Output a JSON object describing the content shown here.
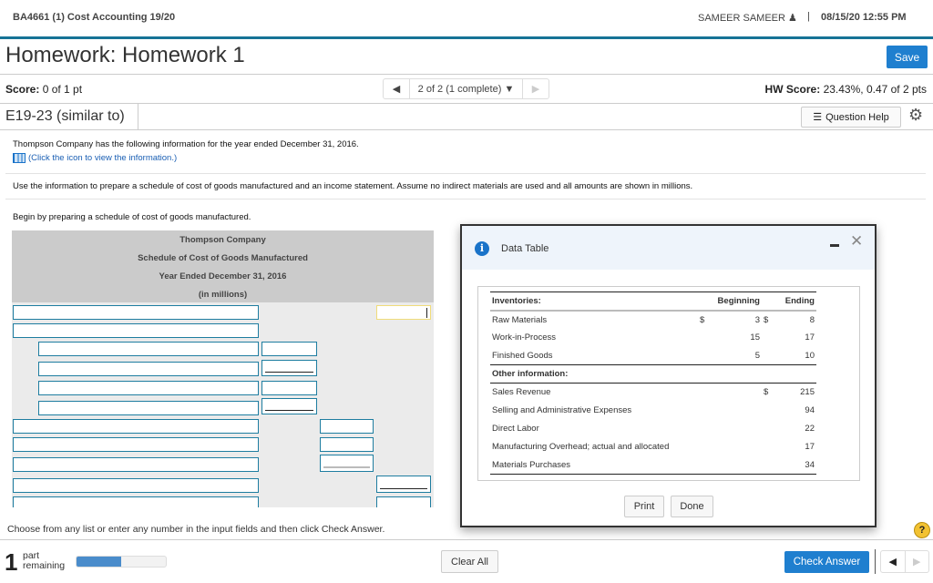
{
  "header": {
    "course": "BA4661 (1) Cost Accounting 19/20",
    "user": "SAMEER SAMEER",
    "separator": "|",
    "datetime": "08/15/20 12:55 PM"
  },
  "page": {
    "title": "Homework: Homework 1",
    "save_label": "Save"
  },
  "scorebar": {
    "score_label": "Score:",
    "score_value": "0 of 1 pt",
    "question_nav": "2 of 2 (1 complete)",
    "hw_score_label": "HW Score:",
    "hw_score_value": "23.43%, 0.47 of 2 pts"
  },
  "question": {
    "id": "E19-23 (similar to)",
    "help_label": "Question Help",
    "intro": "Thompson Company has the following information for the year ended December 31, 2016.",
    "link": "(Click the icon to view the information.)",
    "instructions": "Use the information to prepare a schedule of cost of goods manufactured and an income statement. Assume no indirect materials are used and all amounts are shown in millions.",
    "begin": "Begin by preparing a schedule of cost of goods manufactured."
  },
  "schedule": {
    "lines": [
      "Thompson Company",
      "Schedule of Cost of Goods Manufactured",
      "Year Ended December 31, 2016",
      "(in millions)"
    ]
  },
  "modal": {
    "title": "Data Table",
    "print_label": "Print",
    "done_label": "Done",
    "inventories_header": "Inventories:",
    "beginning_header": "Beginning",
    "ending_header": "Ending",
    "inventories": [
      {
        "label": "Raw Materials",
        "begin_sym": "$",
        "beginning": "3",
        "end_sym": "$",
        "ending": "8"
      },
      {
        "label": "Work-in-Process",
        "beginning": "15",
        "ending": "17"
      },
      {
        "label": "Finished Goods",
        "beginning": "5",
        "ending": "10"
      }
    ],
    "other_header": "Other information:",
    "other": [
      {
        "label": "Sales Revenue",
        "sym": "$",
        "value": "215"
      },
      {
        "label": "Selling and Administrative Expenses",
        "value": "94"
      },
      {
        "label": "Direct Labor",
        "value": "22"
      },
      {
        "label": "Manufacturing Overhead; actual and allocated",
        "value": "17"
      },
      {
        "label": "Materials Purchases",
        "value": "34"
      }
    ]
  },
  "footer": {
    "choose": "Choose from any list or enter any number in the input fields and then click Check Answer.",
    "parts_count": "1",
    "parts_label_1": "part",
    "parts_label_2": "remaining",
    "progress_percent": 50,
    "clear_label": "Clear All",
    "check_label": "Check Answer",
    "help": "?"
  }
}
